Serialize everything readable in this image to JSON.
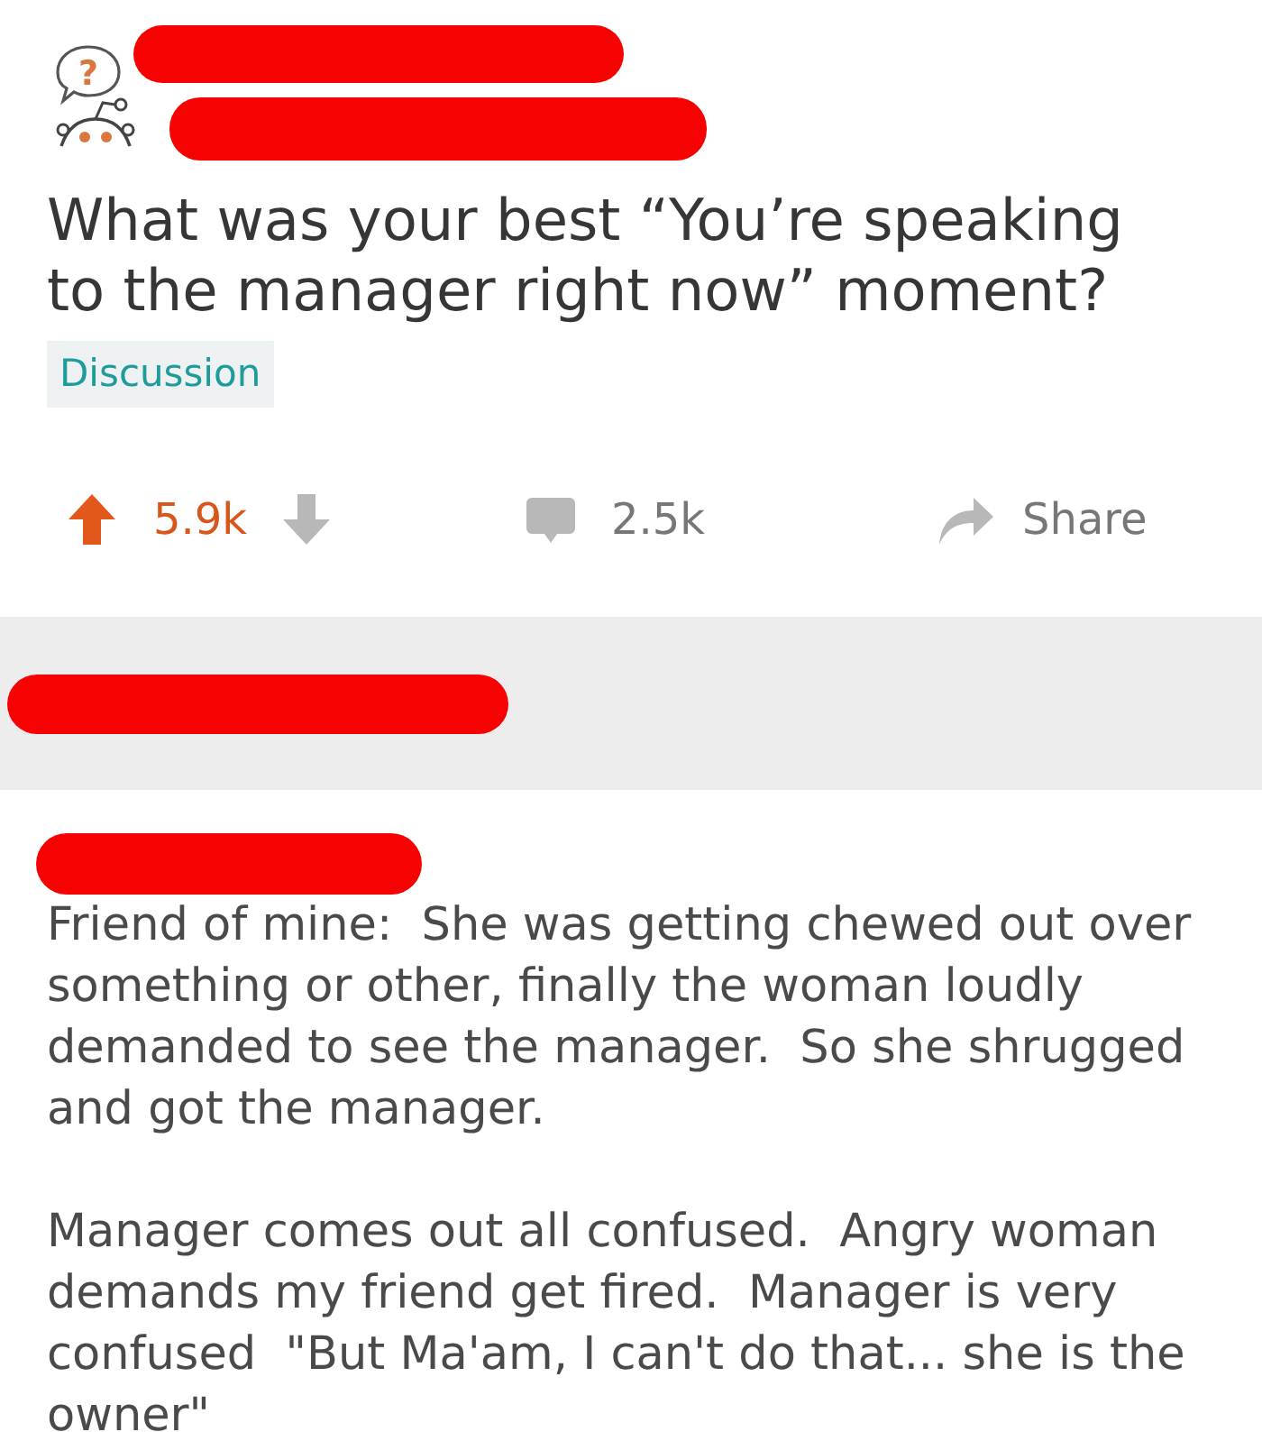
{
  "post": {
    "avatar": {
      "glyph": "?"
    },
    "title": "What was your best “You’re speaking to the manager right now” moment?",
    "flair": "Discussion",
    "score": "5.9k",
    "upvoted": true,
    "comment_count": "2.5k",
    "share_label": "Share"
  },
  "comment": {
    "paragraphs": [
      "Friend of mine:  She was getting chewed out over something or other, finally the woman loudly demanded to see the manager.  So she shrugged and got the manager.",
      "Manager comes out all confused.  Angry woman demands my friend get fired.  Manager is very confused  \"But Ma'am, I can't do that... she is the owner\""
    ]
  }
}
